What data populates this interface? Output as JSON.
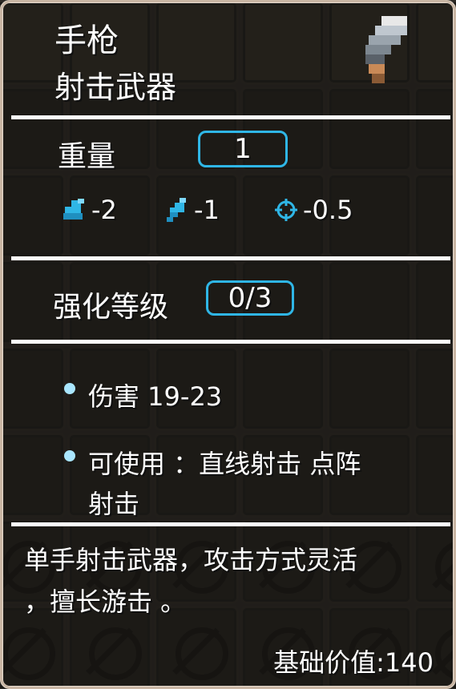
{
  "item": {
    "name": "手枪",
    "type": "射击武器",
    "weight_label": "重量",
    "weight_value": "1",
    "stats": [
      {
        "icon": "strength-arm-icon",
        "value": "-2"
      },
      {
        "icon": "speed-bolt-icon",
        "value": "-1"
      },
      {
        "icon": "accuracy-crosshair-icon",
        "value": "-0.5"
      }
    ],
    "upgrade_label": "强化等级",
    "upgrade_value": "0/3",
    "effects": [
      {
        "text": "伤害 19-23"
      },
      {
        "text_line1": "可使用 ：直线射击 点阵",
        "text_line2": "射击"
      }
    ],
    "description_line1": "单手射击武器，攻击方式灵活",
    "description_line2": "，擅长游击 。",
    "base_value": "基础价值:140"
  },
  "colors": {
    "accent": "#2fb6e6",
    "text": "#ffffff",
    "frame": "#e8ddd1",
    "bullet": "#a9e6ff"
  }
}
